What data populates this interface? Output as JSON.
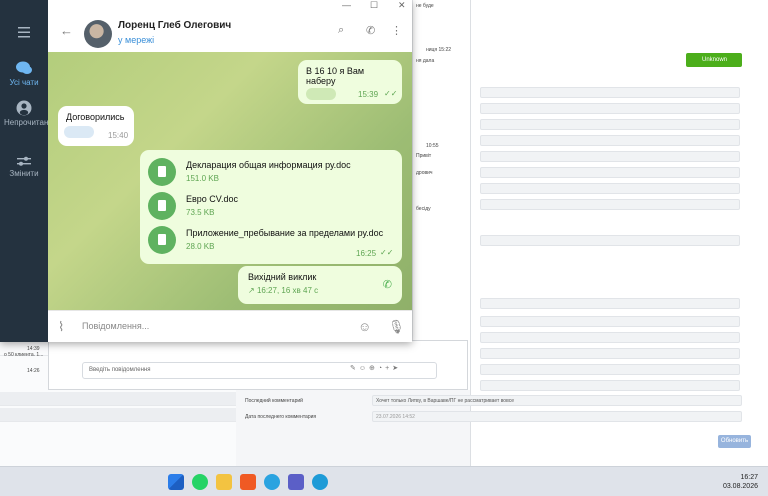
{
  "telegram": {
    "sidebar": [
      {
        "label": "Усі чати",
        "icon": "chat-bubbles-icon"
      },
      {
        "label": "Непрочитано",
        "icon": "person-icon"
      },
      {
        "label": "Змінити",
        "icon": "sliders-icon"
      }
    ],
    "header": {
      "name": "Лоренц Глеб Олегович",
      "status": "у мережі"
    },
    "messages": {
      "out1": {
        "text": "В 16 10 я Вам наберу",
        "time": "15:39"
      },
      "in1": {
        "text": "Договорились",
        "time": "15:40"
      },
      "docs": [
        {
          "name": "Декларация общая информация ру.doc",
          "size": "151.0 KB"
        },
        {
          "name": "Евро CV.doc",
          "size": "73.5 KB"
        },
        {
          "name": "Приложение_пребывание за пределами ру.doc",
          "size": "28.0 KB"
        }
      ],
      "docs_time": "16:25",
      "call": {
        "title": "Вихідний виклик",
        "sub": "16:27, 16 хв 47 с"
      }
    },
    "composer": {
      "placeholder": "Повідомлення..."
    }
  },
  "background": {
    "unknown_button": "Unknown",
    "update_button": "Обновить",
    "message_placeholder": "Введіть повідомлення",
    "last_comment_label": "Последний комментарий",
    "last_comment_value": "Хочет только Литву, в Варшаве/ПГ не рассматривает вовсе",
    "last_comment_date_label": "Дата последнего комментария",
    "last_comment_date_value": "23.07.2026 14:52",
    "snippet_time1": "14:39",
    "snippet_time2": "14:26",
    "snippet_text": "о 50 клиента. 1...",
    "right_snip1": "не буде",
    "right_snip2": "Привіт",
    "right_snip3": "дрович",
    "right_snip4": "бесіду",
    "right_snip5": "ня дала",
    "right_time": "10:55",
    "right_time2": "ниця 15:22"
  },
  "taskbar": {
    "time": "16:27",
    "date": "03.08.2026"
  }
}
